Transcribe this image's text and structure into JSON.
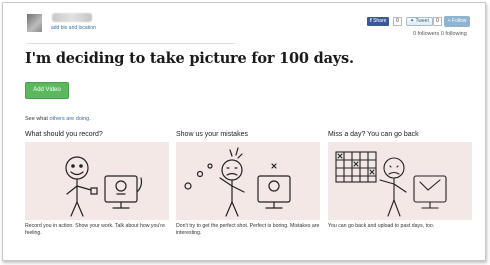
{
  "header": {
    "bio_link": "add bio and location",
    "share_label": "Share",
    "share_count": "0",
    "tweet_label": "Tweet",
    "tweet_count": "0",
    "follow_label": "Follow",
    "follow_stats": "0 followers   0 following"
  },
  "main": {
    "title": "I'm deciding to take picture for 100 days.",
    "add_video_label": "Add Video",
    "see_what_prefix": "See what ",
    "see_what_link": "others are doing."
  },
  "sections": [
    {
      "title": "What should you record?",
      "caption": "Record you in action. Show your work. Talk about how you're feeling."
    },
    {
      "title": "Show us your mistakes",
      "caption": "Don't try to get the perfect shot. Perfect is boring. Mistakes are interesting."
    },
    {
      "title": "Miss a day? You can go back",
      "caption": "You can go back and upload to past days, too."
    }
  ],
  "colors": {
    "panel_bg": "#f3e8e6",
    "add_video_green": "#5cb85c",
    "facebook_blue": "#3b5998",
    "follow_blue": "#8fb4d1",
    "link_blue": "#3a6ea5"
  }
}
